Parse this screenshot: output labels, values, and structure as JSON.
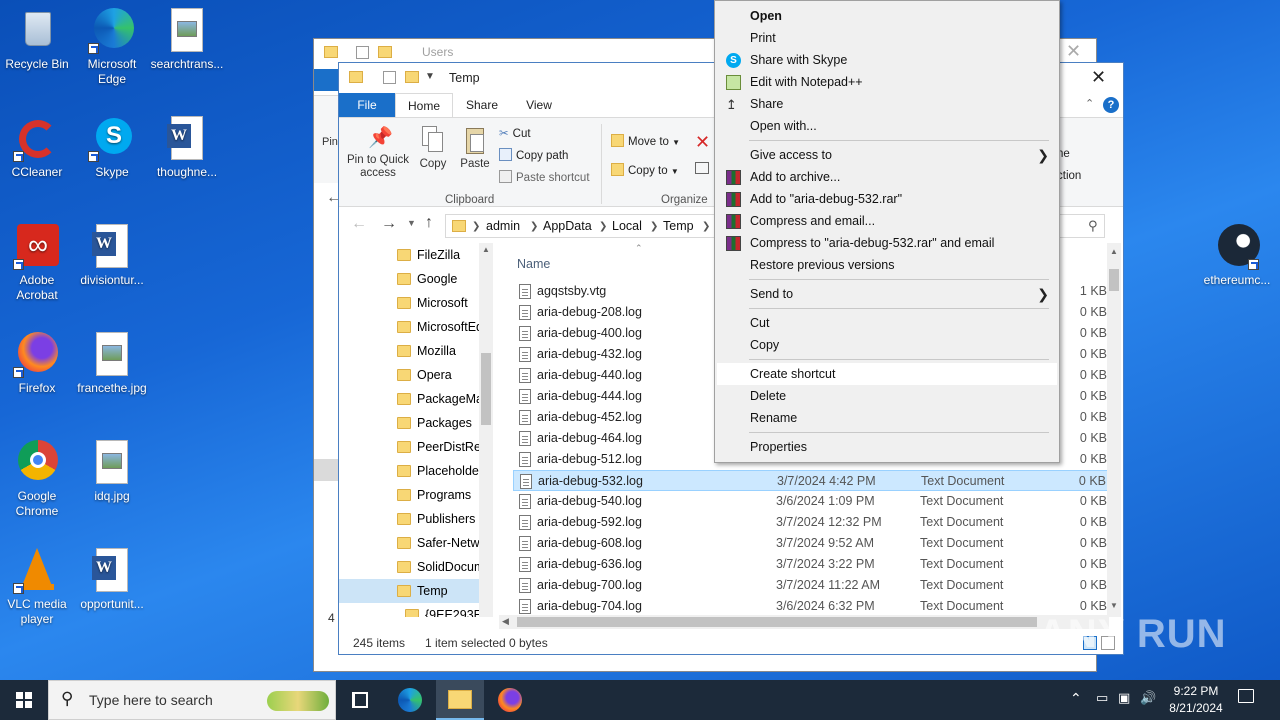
{
  "desktop": {
    "icons_left": [
      {
        "label": "Recycle Bin"
      },
      {
        "label": "Microsoft Edge"
      },
      {
        "label": "searchtrans..."
      },
      {
        "label": "CCleaner"
      },
      {
        "label": "Skype"
      },
      {
        "label": "thoughne..."
      },
      {
        "label": "Adobe Acrobat"
      },
      {
        "label": "divisiontur..."
      },
      {
        "label": "Firefox"
      },
      {
        "label": "francethe.jpg"
      },
      {
        "label": "Google Chrome"
      },
      {
        "label": "idq.jpg"
      },
      {
        "label": "VLC media player"
      },
      {
        "label": "opportunit..."
      }
    ],
    "icon_right": {
      "label": "ethereumc..."
    }
  },
  "back_window": {
    "title": "Users"
  },
  "explorer": {
    "title": "Temp",
    "tabs": {
      "file": "File",
      "home": "Home",
      "share": "Share",
      "view": "View"
    },
    "ribbon": {
      "pin_to_quick_access": "Pin to Quick access",
      "copy": "Copy",
      "paste": "Paste",
      "cut": "Cut",
      "copy_path": "Copy path",
      "paste_shortcut": "Paste shortcut",
      "clipboard_group": "Clipboard",
      "move_to": "Move to",
      "copy_to": "Copy to",
      "organize_group": "Organize",
      "pin_partial": "Pin",
      "new_partial": "ne",
      "selection_partial": "ction"
    },
    "breadcrumb": [
      "admin",
      "AppData",
      "Local",
      "Temp"
    ],
    "nav_items": [
      "FileZilla",
      "Google",
      "Microsoft",
      "MicrosoftEd",
      "Mozilla",
      "Opera",
      "PackageMa",
      "Packages",
      "PeerDistRep",
      "Placeholder",
      "Programs",
      "Publishers",
      "Safer-Netwo",
      "SolidDocum",
      "Temp",
      "{9EE293E3-"
    ],
    "column_name": "Name",
    "files": [
      {
        "name": "agqstsby.vtg",
        "date": "",
        "type": "",
        "size": "1 KB"
      },
      {
        "name": "aria-debug-208.log",
        "date": "",
        "type": "",
        "size": "0 KB"
      },
      {
        "name": "aria-debug-400.log",
        "date": "",
        "type": "",
        "size": "0 KB"
      },
      {
        "name": "aria-debug-432.log",
        "date": "",
        "type": "",
        "size": "0 KB"
      },
      {
        "name": "aria-debug-440.log",
        "date": "",
        "type": "",
        "size": "0 KB"
      },
      {
        "name": "aria-debug-444.log",
        "date": "",
        "type": "",
        "size": "0 KB"
      },
      {
        "name": "aria-debug-452.log",
        "date": "",
        "type": "",
        "size": "0 KB"
      },
      {
        "name": "aria-debug-464.log",
        "date": "",
        "type": "",
        "size": "0 KB"
      },
      {
        "name": "aria-debug-512.log",
        "date": "",
        "type": "",
        "size": "0 KB"
      },
      {
        "name": "aria-debug-532.log",
        "date": "3/7/2024 4:42 PM",
        "type": "Text Document",
        "size": "0 KB"
      },
      {
        "name": "aria-debug-540.log",
        "date": "3/6/2024 1:09 PM",
        "type": "Text Document",
        "size": "0 KB"
      },
      {
        "name": "aria-debug-592.log",
        "date": "3/7/2024 12:32 PM",
        "type": "Text Document",
        "size": "0 KB"
      },
      {
        "name": "aria-debug-608.log",
        "date": "3/7/2024 9:52 AM",
        "type": "Text Document",
        "size": "0 KB"
      },
      {
        "name": "aria-debug-636.log",
        "date": "3/7/2024 3:22 PM",
        "type": "Text Document",
        "size": "0 KB"
      },
      {
        "name": "aria-debug-700.log",
        "date": "3/7/2024 11:22 AM",
        "type": "Text Document",
        "size": "0 KB"
      },
      {
        "name": "aria-debug-704.log",
        "date": "3/6/2024 6:32 PM",
        "type": "Text Document",
        "size": "0 KB"
      }
    ],
    "status": {
      "count": "245 items",
      "selected": "1 item selected",
      "bytes": "0 bytes",
      "left_partial": "4 i"
    }
  },
  "context_menu": {
    "items": [
      {
        "label": "Open"
      },
      {
        "label": "Print"
      },
      {
        "label": "Share with Skype"
      },
      {
        "label": "Edit with Notepad++"
      },
      {
        "label": "Share"
      },
      {
        "label": "Open with..."
      },
      {
        "label": "Give access to"
      },
      {
        "label": "Add to archive..."
      },
      {
        "label": "Add to \"aria-debug-532.rar\""
      },
      {
        "label": "Compress and email..."
      },
      {
        "label": "Compress to \"aria-debug-532.rar\" and email"
      },
      {
        "label": "Restore previous versions"
      },
      {
        "label": "Send to"
      },
      {
        "label": "Cut"
      },
      {
        "label": "Copy"
      },
      {
        "label": "Create shortcut"
      },
      {
        "label": "Delete"
      },
      {
        "label": "Rename"
      },
      {
        "label": "Properties"
      }
    ]
  },
  "taskbar": {
    "search_placeholder": "Type here to search",
    "time": "9:22 PM",
    "date": "8/21/2024"
  },
  "watermark": "ANY RUN"
}
